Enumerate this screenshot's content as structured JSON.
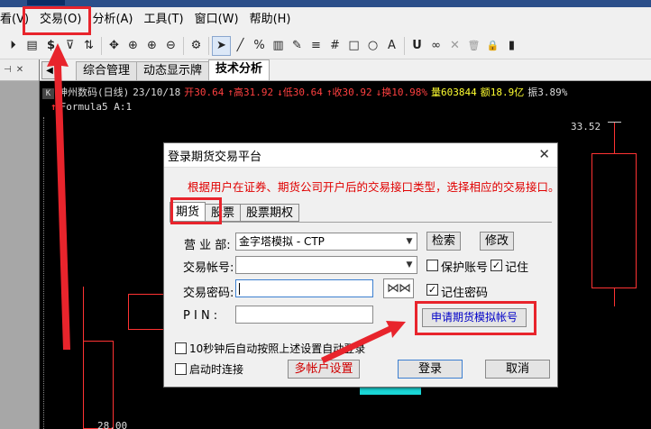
{
  "menu": [
    "看(V)",
    "交易(O)",
    "分析(A)",
    "工具(T)",
    "窗口(W)",
    "帮助(H)"
  ],
  "toolbar": {
    "icons": [
      "play-circle-icon",
      "document-icon",
      "dollar-icon",
      "filter-icon",
      "sort-icon",
      "move-icon",
      "zoom-fit-icon",
      "zoom-in-icon",
      "zoom-out-icon",
      "settings-icon",
      "pointer-icon",
      "line-icon",
      "percent-icon",
      "bars-icon",
      "pen-icon",
      "align-icon",
      "grid-icon",
      "square-icon",
      "circle-icon",
      "text-a-icon",
      "magnet-icon",
      "link-icon",
      "close-icon",
      "trash-icon",
      "lock-icon",
      "more-icon"
    ],
    "glyphs": [
      "⏵",
      "▤",
      "$",
      "⊽",
      "⇅",
      "✥",
      "⊕",
      "⊕",
      "⊖",
      "⚙",
      "➤",
      "╱",
      "%",
      "▥",
      "✎",
      "≡",
      "#",
      "□",
      "○",
      "A",
      "U",
      "∞",
      "✕",
      "🗑",
      "🔒",
      "▮"
    ]
  },
  "tabs": [
    "综合管理",
    "动态显示牌",
    "技术分析"
  ],
  "quote": {
    "name": "神州数码(日线)",
    "date": "23/10/18",
    "open": "开30.64",
    "high": "↑高31.92",
    "low": "↓低30.64",
    "close": "↑收30.92",
    "turnover": "↓换10.98%",
    "volume": "量603844",
    "amount": "额18.9亿",
    "amplitude": "振3.89%"
  },
  "formula": "Formula5 A:1",
  "price_labels": [
    "33.52",
    "28.00"
  ],
  "dialog": {
    "title": "登录期货交易平台",
    "close_glyph": "✕",
    "notice": "根据用户在证券、期货公司开户后的交易接口类型，选择相应的交易接口。",
    "tabs": [
      "期货",
      "股票",
      "股票期权"
    ],
    "broker_label": "营 业 部:",
    "broker_value": "金字塔模拟 - CTP",
    "search_button": "检索",
    "modify_button": "修改",
    "account_label": "交易帐号:",
    "account_value": "",
    "protect_account": "保护账号",
    "remember": "记住",
    "password_label": "交易密码:",
    "remember_password": "记住密码",
    "pin_label": "P I N :",
    "apply_button": "申请期货模拟帐号",
    "auto_login": "10秒钟后自动按照上述设置自动登录",
    "startup_connect": "启动时连接",
    "multi_account_button": "多帐户设置",
    "login_button": "登录",
    "cancel_button": "取消",
    "checks": {
      "protect_account": false,
      "remember": true,
      "remember_password": true,
      "auto_login": false,
      "startup_connect": false
    }
  },
  "colors": {
    "accent_red": "#e8242c",
    "notice_red": "#e00000",
    "link_blue": "#0000c8"
  }
}
